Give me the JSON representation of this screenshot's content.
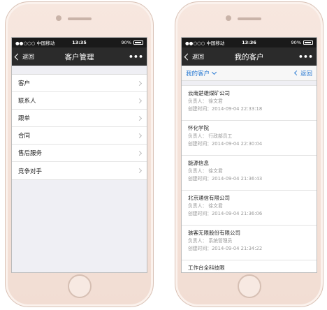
{
  "left_phone": {
    "status": {
      "carrier": "●●○○○ 中国移动",
      "time": "13:35",
      "battery": "90%"
    },
    "nav": {
      "back": "返回",
      "title": "客户管理",
      "more": "•••"
    },
    "items": [
      {
        "label": "客户"
      },
      {
        "label": "联系人"
      },
      {
        "label": "跟单"
      },
      {
        "label": "合同"
      },
      {
        "label": "售后服务"
      },
      {
        "label": "竞争对手"
      }
    ]
  },
  "right_phone": {
    "status": {
      "carrier": "●●○○○ 中国移动",
      "time": "13:36",
      "battery": "90%"
    },
    "nav": {
      "back": "返回",
      "title": "我的客户",
      "more": "•••"
    },
    "filter": {
      "label": "我的客户",
      "back": "返回"
    },
    "customers": [
      {
        "name": "云南楚雄煤矿公司",
        "owner": "负责人：  徐文君",
        "created": "创建时间：2014-09-04 22:33:18"
      },
      {
        "name": "怀化学院",
        "owner": "负责人：  行政部员工",
        "created": "创建时间：2014-09-04 22:30:04"
      },
      {
        "name": "能源信息",
        "owner": "负责人：  徐文君",
        "created": "创建时间：2014-09-04 21:36:43"
      },
      {
        "name": "北京通信有限公司",
        "owner": "负责人：  徐文君",
        "created": "创建时间：2014-09-04 21:36:06"
      },
      {
        "name": "骇客无限股份有限公司",
        "owner": "负责人：  系统管理员",
        "created": "创建时间：2014-09-04 21:34:22"
      },
      {
        "name": "工作台全科技限",
        "owner": "",
        "created": ""
      }
    ]
  }
}
